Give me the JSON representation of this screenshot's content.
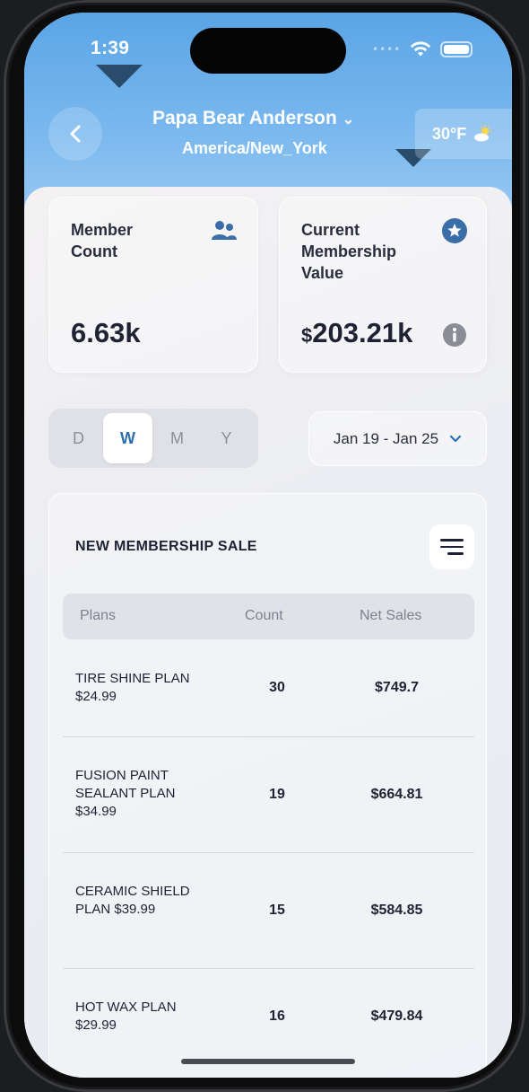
{
  "status_bar": {
    "time": "1:39"
  },
  "header": {
    "name": "Papa Bear Anderson",
    "timezone": "America/New_York",
    "weather_temp": "30°F",
    "weather_icon": "partly-sunny-icon"
  },
  "cards": {
    "member_count": {
      "label_line1": "Member",
      "label_line2": "Count",
      "value": "6.63k",
      "icon": "users-icon"
    },
    "membership_value": {
      "label_line1": "Current",
      "label_line2": "Membership",
      "label_line3": "Value",
      "currency": "$",
      "value": "203.21k",
      "icon": "star-badge-icon",
      "info_icon": "info-icon"
    }
  },
  "period_selector": {
    "options": [
      "D",
      "W",
      "M",
      "Y"
    ],
    "selected": "W"
  },
  "date_range": {
    "label": "Jan 19 - Jan 25"
  },
  "sales": {
    "title": "NEW MEMBERSHIP SALE",
    "columns": [
      "Plans",
      "Count",
      "Net Sales"
    ],
    "rows": [
      {
        "plan": "TIRE SHINE PLAN $24.99",
        "count": "30",
        "net": "$749.7"
      },
      {
        "plan": "FUSION PAINT SEALANT PLAN $34.99",
        "count": "19",
        "net": "$664.81"
      },
      {
        "plan": "CERAMIC SHIELD PLAN $39.99",
        "count": "15",
        "net": "$584.85"
      },
      {
        "plan": "HOT WAX PLAN $29.99",
        "count": "16",
        "net": "$479.84"
      }
    ]
  },
  "colors": {
    "accent": "#2e6fb0",
    "header_blue": "#5aa5e6",
    "text": "#1f2233"
  }
}
